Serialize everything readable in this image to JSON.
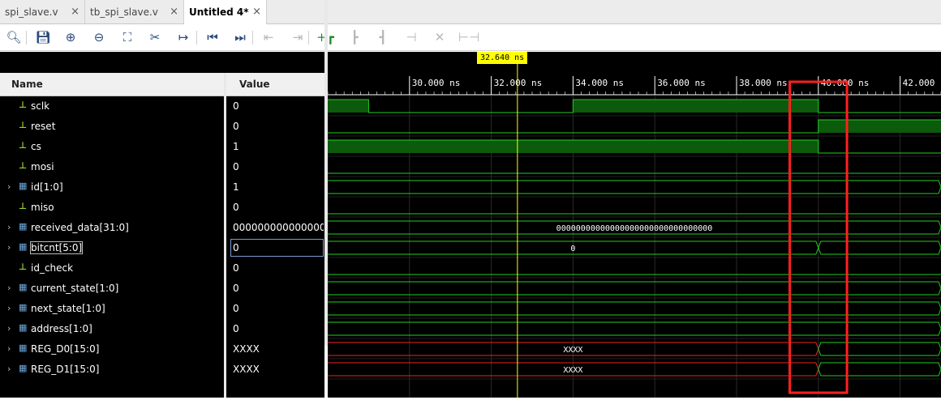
{
  "tabs": [
    {
      "label": "spi_slave.v",
      "active": false
    },
    {
      "label": "tb_spi_slave.v",
      "active": false
    },
    {
      "label": "Untitled 4*",
      "active": true
    }
  ],
  "tab_close_glyph": "×",
  "toolbar_icons": [
    {
      "name": "search-icon",
      "glyph": "🔍︎",
      "state": "enabled"
    },
    {
      "name": "save-icon",
      "glyph": "💾︎",
      "state": "enabled"
    },
    {
      "name": "zoom-in-icon",
      "glyph": "⊕",
      "state": "enabled"
    },
    {
      "name": "zoom-out-icon",
      "glyph": "⊖",
      "state": "enabled"
    },
    {
      "name": "zoom-fit-icon",
      "glyph": "⛶",
      "state": "enabled"
    },
    {
      "name": "swap-cursor-icon",
      "glyph": "✂",
      "state": "enabled"
    },
    {
      "name": "go-to-cursor-icon",
      "glyph": "↦",
      "state": "enabled"
    },
    {
      "name": "go-to-start-icon",
      "glyph": "⏮",
      "state": "enabled"
    },
    {
      "name": "go-to-end-icon",
      "glyph": "⏭",
      "state": "enabled"
    },
    {
      "name": "prev-transition-icon",
      "glyph": "⇤",
      "state": "disabled"
    },
    {
      "name": "next-transition-icon",
      "glyph": "⇥",
      "state": "disabled"
    },
    {
      "name": "add-marker-icon",
      "glyph": "+┏",
      "state": "enabled"
    },
    {
      "name": "prev-marker-icon",
      "glyph": "┣",
      "state": "disabled"
    },
    {
      "name": "next-marker-icon",
      "glyph": "┫",
      "state": "disabled"
    },
    {
      "name": "swap-markers-icon",
      "glyph": "⊣",
      "state": "disabled"
    },
    {
      "name": "delete-marker-icon",
      "glyph": "✕",
      "state": "disabled"
    },
    {
      "name": "snap-icon",
      "glyph": "⊢⊣",
      "state": "disabled"
    }
  ],
  "columns": {
    "name": "Name",
    "value": "Value"
  },
  "signals": [
    {
      "name": "sclk",
      "value": "0",
      "kind": "bit",
      "expandable": false
    },
    {
      "name": "reset",
      "value": "0",
      "kind": "bit",
      "expandable": false
    },
    {
      "name": "cs",
      "value": "1",
      "kind": "bit",
      "expandable": false
    },
    {
      "name": "mosi",
      "value": "0",
      "kind": "bit",
      "expandable": false
    },
    {
      "name": "id[1:0]",
      "value": "1",
      "kind": "bus",
      "expandable": true
    },
    {
      "name": "miso",
      "value": "0",
      "kind": "bit",
      "expandable": false
    },
    {
      "name": "received_data[31:0]",
      "value": "00000000000000000000000000000000",
      "kind": "bus",
      "expandable": true
    },
    {
      "name": "bitcnt[5:0]",
      "value": "0",
      "kind": "bus",
      "expandable": true
    },
    {
      "name": "id_check",
      "value": "0",
      "kind": "bit",
      "expandable": false
    },
    {
      "name": "current_state[1:0]",
      "value": "0",
      "kind": "bus",
      "expandable": true
    },
    {
      "name": "next_state[1:0]",
      "value": "0",
      "kind": "bus",
      "expandable": true
    },
    {
      "name": "address[1:0]",
      "value": "0",
      "kind": "bus",
      "expandable": true
    },
    {
      "name": "REG_D0[15:0]",
      "value": "XXXX",
      "kind": "bus",
      "expandable": true
    },
    {
      "name": "REG_D1[15:0]",
      "value": "XXXX",
      "kind": "bus",
      "expandable": true
    }
  ],
  "selected_signal": "bitcnt[5:0]",
  "icon_glyphs": {
    "bit": "⊥",
    "bus": "▦",
    "expand": "›"
  },
  "timeline": {
    "cursor": "32.640 ns",
    "cursor_time": 32.64,
    "start": 28.0,
    "end": 43.0,
    "ticks": [
      "30.000 ns",
      "32.000 ns",
      "34.000 ns",
      "36.000 ns",
      "38.000 ns",
      "40.000 ns",
      "42.000 ns"
    ],
    "tick_times": [
      30,
      32,
      34,
      36,
      38,
      40,
      42
    ],
    "highlight_range": [
      39.3,
      40.7
    ]
  },
  "waves": [
    {
      "type": "bit",
      "segments": [
        [
          28,
          29,
          1
        ],
        [
          29,
          34,
          0
        ],
        [
          34,
          40,
          1
        ],
        [
          40,
          43,
          0
        ]
      ]
    },
    {
      "type": "bit",
      "segments": [
        [
          28,
          40,
          0
        ],
        [
          40,
          43,
          1
        ]
      ]
    },
    {
      "type": "bit",
      "segments": [
        [
          28,
          40,
          1
        ],
        [
          40,
          43,
          0
        ]
      ]
    },
    {
      "type": "bit",
      "segments": [
        [
          28,
          43,
          0
        ]
      ]
    },
    {
      "type": "bus",
      "color": "green",
      "segments": [
        [
          28,
          43,
          ""
        ]
      ]
    },
    {
      "type": "bit",
      "segments": [
        [
          28,
          43,
          0
        ]
      ]
    },
    {
      "type": "bus",
      "color": "green",
      "segments": [
        [
          28,
          43,
          "00000000000000000000000000000000"
        ]
      ]
    },
    {
      "type": "bus",
      "color": "green",
      "segments": [
        [
          28,
          40,
          "0"
        ],
        [
          40,
          43,
          ""
        ]
      ]
    },
    {
      "type": "bit",
      "segments": [
        [
          28,
          43,
          0
        ]
      ]
    },
    {
      "type": "bus",
      "color": "green",
      "segments": [
        [
          28,
          43,
          ""
        ]
      ]
    },
    {
      "type": "bus",
      "color": "green",
      "segments": [
        [
          28,
          43,
          ""
        ]
      ]
    },
    {
      "type": "bus",
      "color": "green",
      "segments": [
        [
          28,
          43,
          ""
        ]
      ]
    },
    {
      "type": "bus",
      "color": "red",
      "segments": [
        [
          28,
          40,
          "XXXX"
        ],
        [
          40,
          43,
          ""
        ]
      ],
      "after_color": "green"
    },
    {
      "type": "bus",
      "color": "red",
      "segments": [
        [
          28,
          40,
          "XXXX"
        ],
        [
          40,
          43,
          ""
        ]
      ],
      "after_color": "green"
    }
  ],
  "colors": {
    "wave_green": "#22cc22",
    "wave_fill": "#0c5a0c",
    "wave_red": "#ee2222",
    "highlight_box": "#ff2020",
    "cursor": "#ffff00",
    "grid": "#1f1f1f",
    "ruler_text": "#ffffff"
  }
}
